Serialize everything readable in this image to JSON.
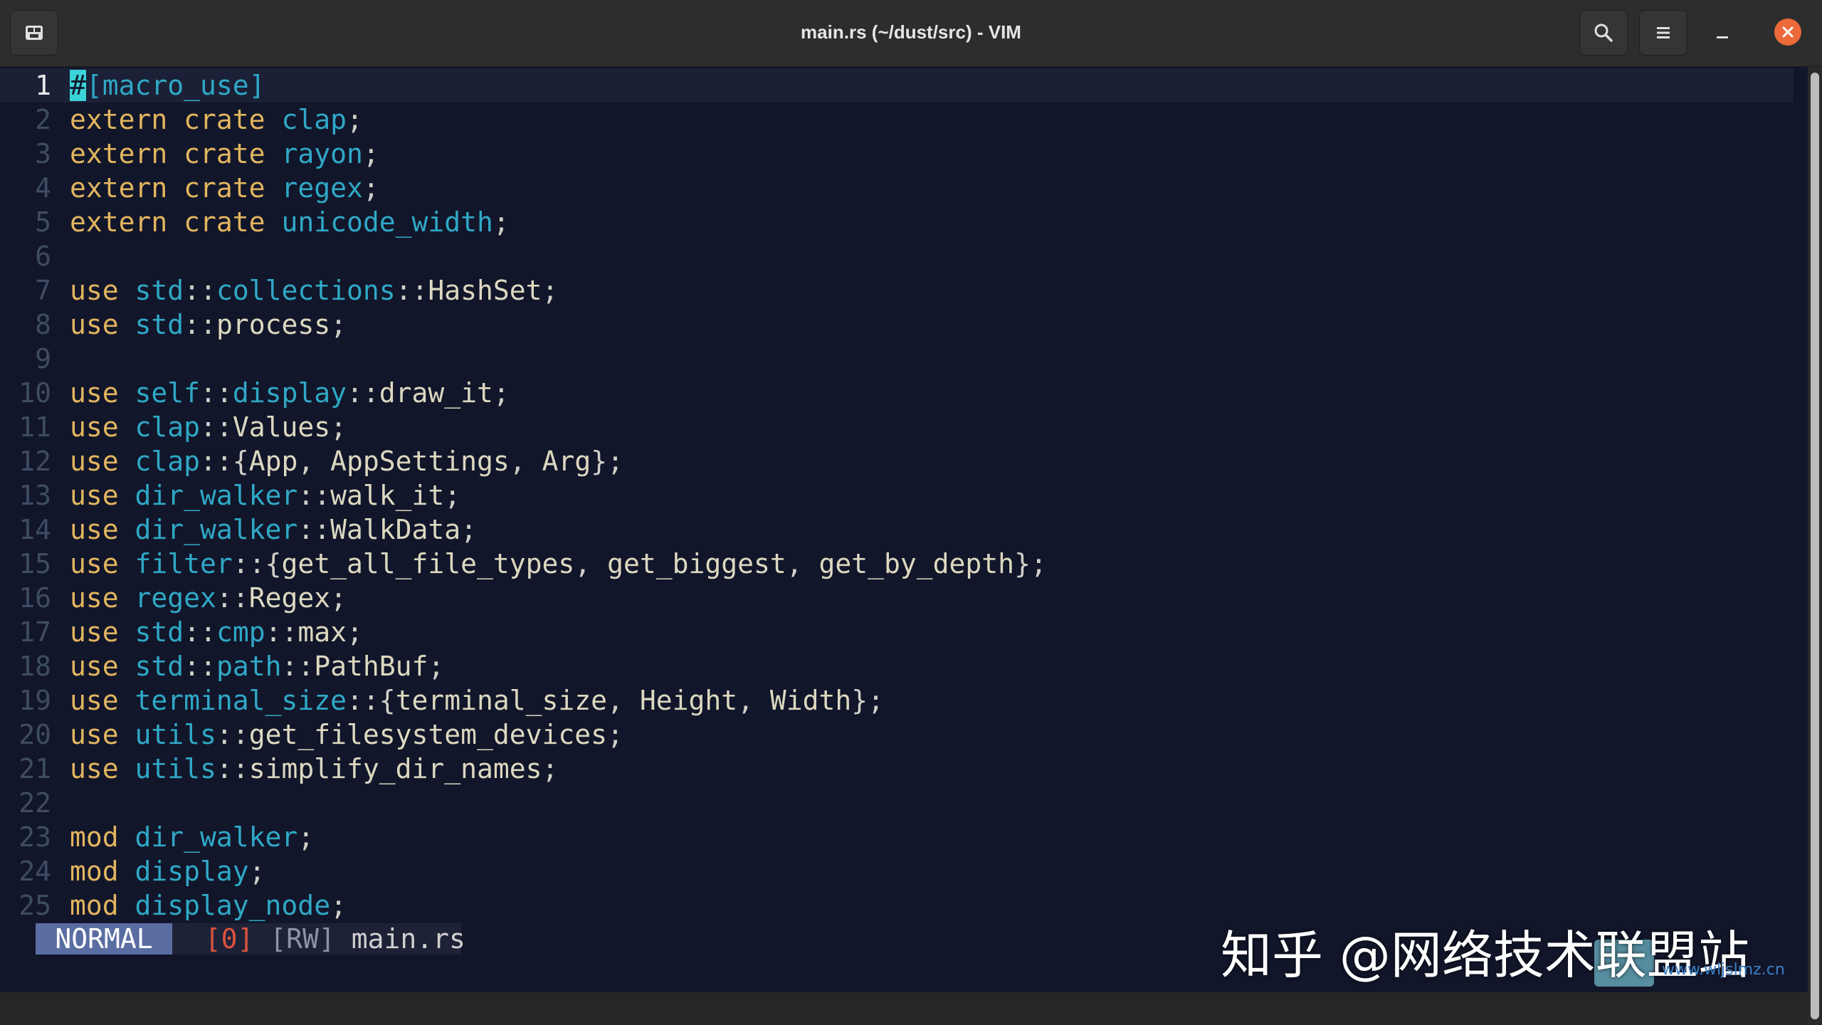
{
  "window": {
    "title": "main.rs (~/dust/src) - VIM",
    "buttons": {
      "new_tab": "terminal-icon",
      "search": "search-icon",
      "menu": "hamburger-menu-icon",
      "minimize": "minimize-icon",
      "close": "close-icon"
    },
    "close_color": "#ec6a3a"
  },
  "editor": {
    "current_line": 1,
    "lines": [
      {
        "n": "1",
        "text": "#[macro_use]"
      },
      {
        "n": "2",
        "text": "extern crate clap;"
      },
      {
        "n": "3",
        "text": "extern crate rayon;"
      },
      {
        "n": "4",
        "text": "extern crate regex;"
      },
      {
        "n": "5",
        "text": "extern crate unicode_width;"
      },
      {
        "n": "6",
        "text": ""
      },
      {
        "n": "7",
        "text": "use std::collections::HashSet;"
      },
      {
        "n": "8",
        "text": "use std::process;"
      },
      {
        "n": "9",
        "text": ""
      },
      {
        "n": "10",
        "text": "use self::display::draw_it;"
      },
      {
        "n": "11",
        "text": "use clap::Values;"
      },
      {
        "n": "12",
        "text": "use clap::{App, AppSettings, Arg};"
      },
      {
        "n": "13",
        "text": "use dir_walker::walk_it;"
      },
      {
        "n": "14",
        "text": "use dir_walker::WalkData;"
      },
      {
        "n": "15",
        "text": "use filter::{get_all_file_types, get_biggest, get_by_depth};"
      },
      {
        "n": "16",
        "text": "use regex::Regex;"
      },
      {
        "n": "17",
        "text": "use std::cmp::max;"
      },
      {
        "n": "18",
        "text": "use std::path::PathBuf;"
      },
      {
        "n": "19",
        "text": "use terminal_size::{terminal_size, Height, Width};"
      },
      {
        "n": "20",
        "text": "use utils::get_filesystem_devices;"
      },
      {
        "n": "21",
        "text": "use utils::simplify_dir_names;"
      },
      {
        "n": "22",
        "text": ""
      },
      {
        "n": "23",
        "text": "mod dir_walker;"
      },
      {
        "n": "24",
        "text": "mod display;"
      },
      {
        "n": "25",
        "text": "mod display_node;"
      }
    ]
  },
  "statusline": {
    "mode": "NORMAL",
    "buffer": "[0]",
    "flags": "[RW]",
    "filename": "main.rs"
  },
  "watermark": {
    "text": "知乎 @网络技术联盟站",
    "site": "www.wljslmz.cn"
  }
}
